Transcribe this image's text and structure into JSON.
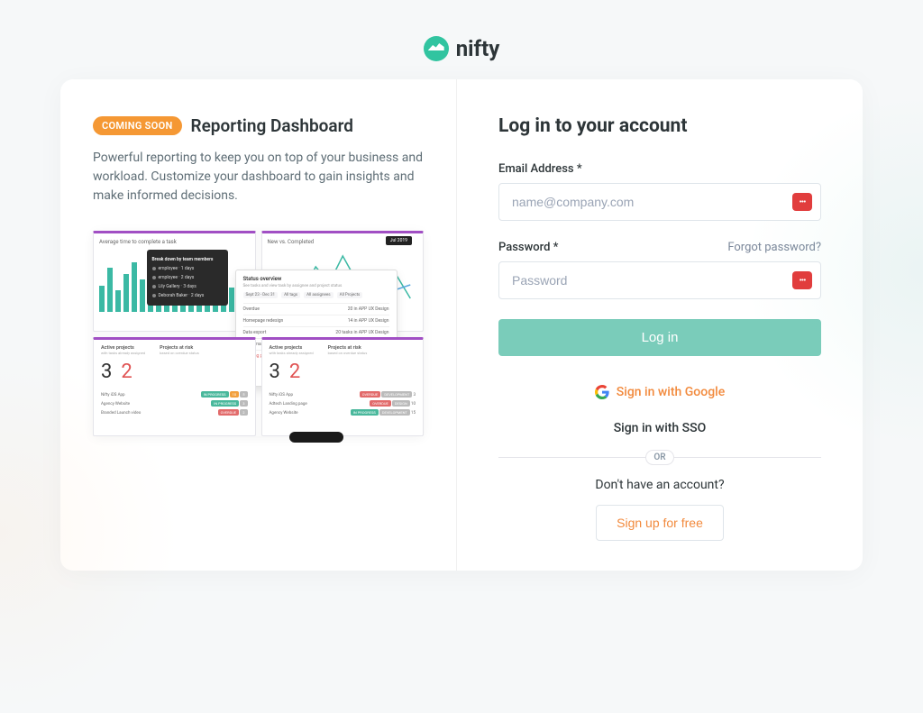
{
  "brand": {
    "name": "nifty"
  },
  "promo": {
    "badge": "COMING SOON",
    "title": "Reporting Dashboard",
    "description": "Powerful reporting to keep you on top of your business and workload. Customize your dashboard to gain insights and make informed decisions.",
    "chart1_title": "Average time to complete a task",
    "chart2_title": "New vs. Completed",
    "stat_left_header": "Active projects",
    "stat_left_header2": "Projects at risk",
    "stat_right_header": "Active projects",
    "stat_right_header2": "Projects at risk",
    "stat_num1": "3",
    "stat_num2": "2",
    "stat_num3": "3",
    "stat_num4": "2"
  },
  "login": {
    "title": "Log in to your account",
    "email_label": "Email Address *",
    "email_placeholder": "name@company.com",
    "password_label": "Password *",
    "password_placeholder": "Password",
    "forgot_link": "Forgot password?",
    "login_button": "Log in",
    "google_button": "Sign in with Google",
    "sso_button": "Sign in with SSO",
    "divider": "OR",
    "no_account": "Don't have an account?",
    "signup_button": "Sign up for free"
  }
}
